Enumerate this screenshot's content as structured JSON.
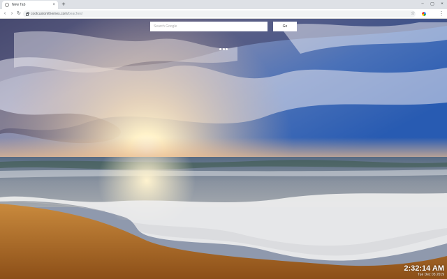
{
  "browser": {
    "tab": {
      "title": "New Tab",
      "close_glyph": "×",
      "favicon": "globe-icon"
    },
    "new_tab_glyph": "+",
    "window_controls": [
      "–",
      "▢",
      "×"
    ],
    "nav": {
      "back": "‹",
      "forward": "›",
      "reload": "↻"
    },
    "address": {
      "host": "coolcustomthemes.com",
      "path": "/beaches/"
    },
    "star_glyph": "☆",
    "menu_glyph": "⋮"
  },
  "search": {
    "placeholder": "Search Google",
    "button_label": "Go"
  },
  "clock": {
    "time": "2:32:14 AM",
    "date": "Tue Dec 03 2019"
  },
  "colors": {
    "sky_top": "#3b3f6a",
    "sky_blue": "#2f62b6",
    "sun": "#fff6d8",
    "sea": "#6f7f92",
    "sand": "#c0782c",
    "foam": "#f2f2f2"
  }
}
